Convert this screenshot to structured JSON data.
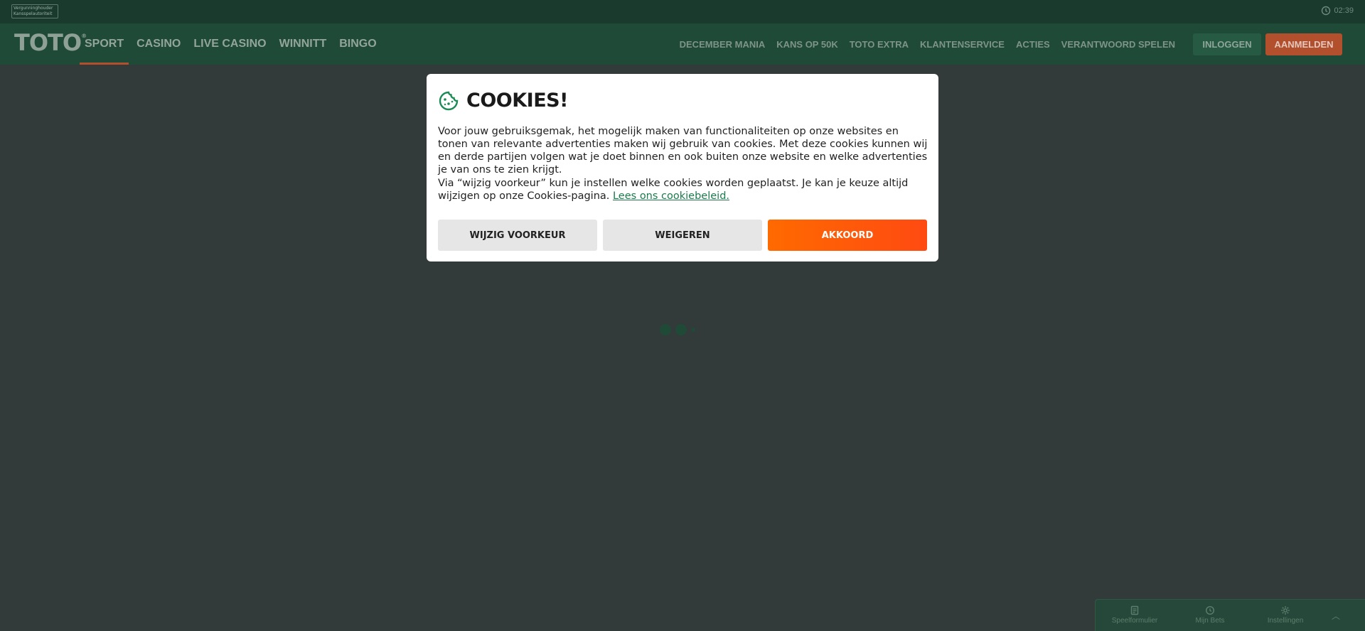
{
  "topbar": {
    "license_badge": "Vergunninghouder Kansspelautoriteit",
    "time": "02:39"
  },
  "logo": {
    "text": "TOTO",
    "reg": "®"
  },
  "main_nav": [
    {
      "label": "SPORT",
      "active": true
    },
    {
      "label": "CASINO",
      "active": false
    },
    {
      "label": "LIVE CASINO",
      "active": false
    },
    {
      "label": "WINNITT",
      "active": false
    },
    {
      "label": "BINGO",
      "active": false
    }
  ],
  "secondary_nav": [
    {
      "label": "DECEMBER MANIA"
    },
    {
      "label": "KANS OP 50K"
    },
    {
      "label": "TOTO EXTRA"
    },
    {
      "label": "KLANTENSERVICE"
    },
    {
      "label": "ACTIES"
    },
    {
      "label": "VERANTWOORD SPELEN"
    }
  ],
  "account": {
    "login_label": "INLOGGEN",
    "signup_label": "AANMELDEN"
  },
  "cookie_modal": {
    "title": "COOKIES!",
    "paragraph1": "Voor jouw gebruiksgemak, het mogelijk maken van functionaliteiten op onze websites en tonen van relevante advertenties maken wij gebruik van cookies. Met deze cookies kunnen wij en derde partijen volgen wat je doet binnen en ook buiten onze website en welke advertenties je van ons te zien krijgt.",
    "paragraph2": "Via “wijzig voorkeur” kun je instellen welke cookies worden geplaatst. Je kan je keuze altijd wijzigen op onze Cookies-pagina. ",
    "policy_link": "Lees ons cookiebeleid.",
    "buttons": {
      "preferences": "WIJZIG VOORKEUR",
      "reject": "WEIGEREN",
      "accept": "AKKOORD"
    }
  },
  "bottom_widget": {
    "items": [
      {
        "label": "Speelformulier",
        "icon": "form-icon"
      },
      {
        "label": "Mijn Bets",
        "icon": "history-icon"
      },
      {
        "label": "Instellingen",
        "icon": "gear-icon"
      }
    ]
  },
  "colors": {
    "brand_green": "#1f4a37",
    "accent_orange": "#ff5a00",
    "overlay_bg": "#333a3a",
    "link_green": "#1c7a4c"
  }
}
